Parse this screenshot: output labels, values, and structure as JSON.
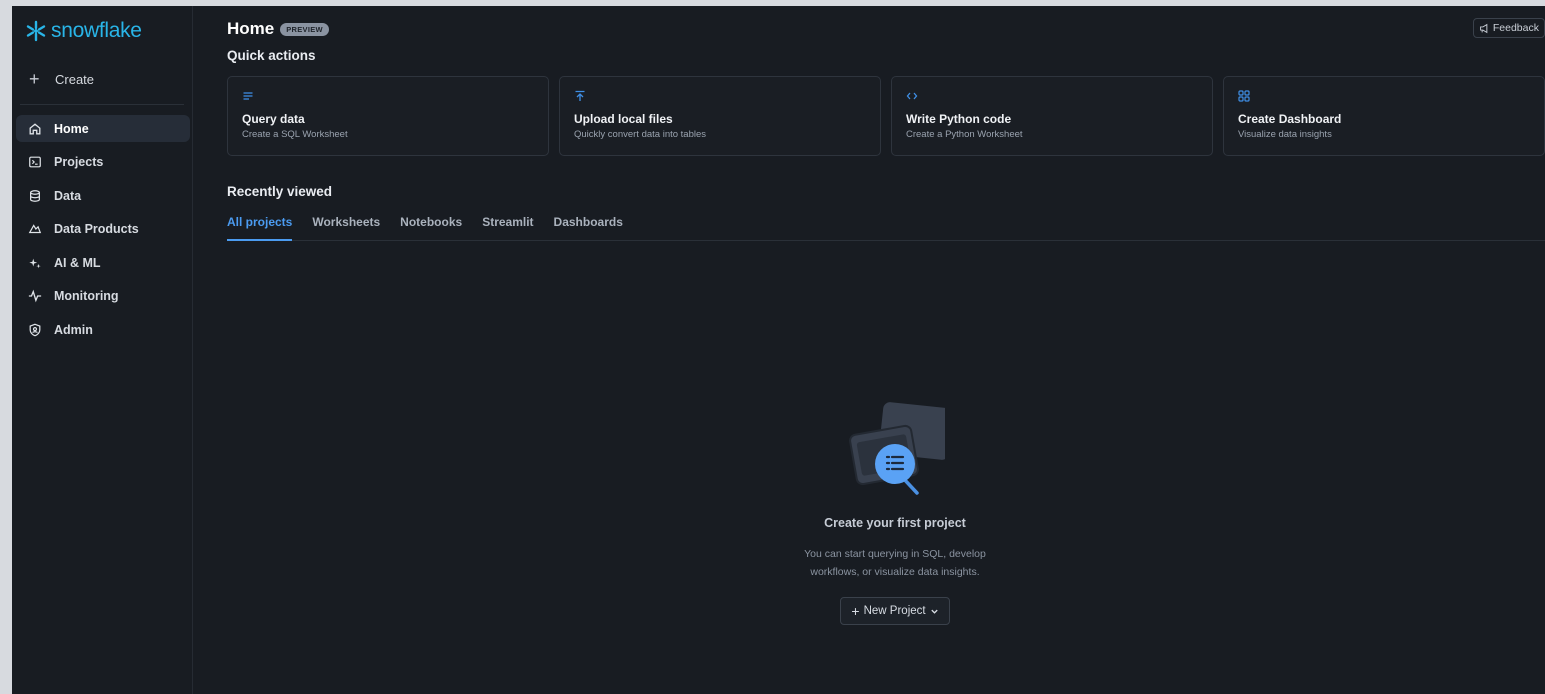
{
  "brand": {
    "name": "snowflake",
    "color": "#29b5e8"
  },
  "sidebar": {
    "create_label": "Create",
    "items": [
      {
        "label": "Home",
        "icon": "home-icon",
        "active": true
      },
      {
        "label": "Projects",
        "icon": "terminal-icon"
      },
      {
        "label": "Data",
        "icon": "database-icon"
      },
      {
        "label": "Data Products",
        "icon": "cloud-icon"
      },
      {
        "label": "AI & ML",
        "icon": "sparkle-icon"
      },
      {
        "label": "Monitoring",
        "icon": "pulse-icon"
      },
      {
        "label": "Admin",
        "icon": "shield-icon"
      }
    ]
  },
  "header": {
    "title": "Home",
    "badge": "PREVIEW",
    "feedback_label": "Feedback"
  },
  "quick_actions": {
    "title": "Quick actions",
    "cards": [
      {
        "title": "Query data",
        "subtitle": "Create a SQL Worksheet",
        "icon": "lines-icon"
      },
      {
        "title": "Upload local files",
        "subtitle": "Quickly convert data into tables",
        "icon": "upload-icon"
      },
      {
        "title": "Write Python code",
        "subtitle": "Create a Python Worksheet",
        "icon": "code-icon"
      },
      {
        "title": "Create Dashboard",
        "subtitle": "Visualize data insights",
        "icon": "grid-icon"
      }
    ]
  },
  "recent": {
    "title": "Recently viewed",
    "tabs": [
      "All projects",
      "Worksheets",
      "Notebooks",
      "Streamlit",
      "Dashboards"
    ],
    "active_tab": "All projects"
  },
  "empty_state": {
    "title": "Create your first project",
    "description_line1": "You can start querying in SQL, develop",
    "description_line2": "workflows, or visualize data insights.",
    "button_label": "New Project"
  },
  "colors": {
    "accent": "#4b9bf0",
    "background": "#181c22"
  }
}
